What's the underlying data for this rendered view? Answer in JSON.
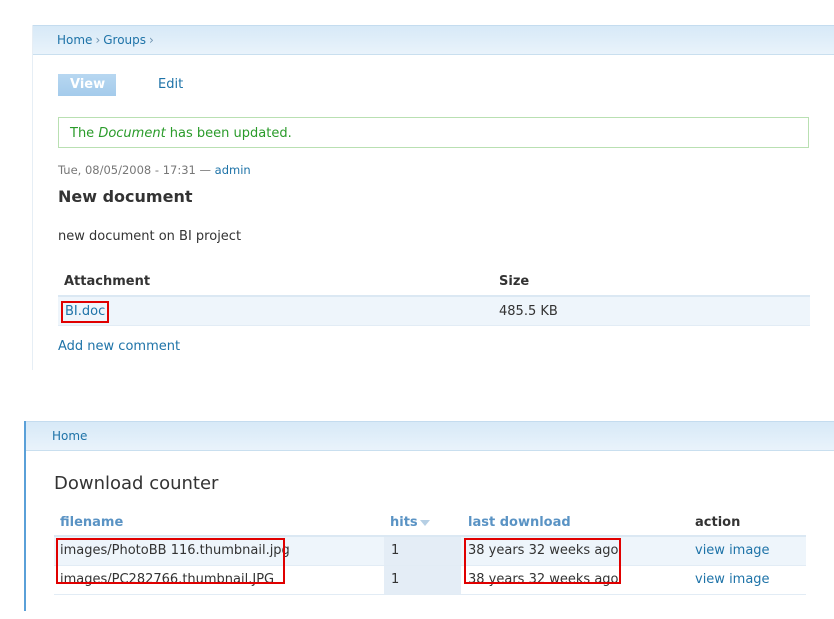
{
  "panel1": {
    "breadcrumb": [
      "Home",
      "Groups"
    ],
    "breadcrumb_sep": "›",
    "tabs": [
      "View",
      "Edit"
    ],
    "message": {
      "prefix": "The ",
      "em": "Document",
      "suffix": " has been updated."
    },
    "submitted": "Tue, 08/05/2008 - 17:31 — ",
    "author": "admin",
    "node_title": "New document",
    "body": "new document on BI project",
    "attachments": {
      "headers": [
        "Attachment",
        "Size"
      ],
      "rows": [
        {
          "file": "BI.doc",
          "size": "485.5 KB"
        }
      ]
    },
    "add_comment": "Add new comment"
  },
  "panel2": {
    "breadcrumb": [
      "Home"
    ],
    "title": "Download counter",
    "headers": [
      "filename",
      "hits",
      "last download",
      "action"
    ],
    "rows": [
      {
        "filename": "images/PhotoBB 116.thumbnail.jpg",
        "hits": "1",
        "last": "38 years 32 weeks ago",
        "action": "view image"
      },
      {
        "filename": "images/PC282766.thumbnail.JPG",
        "hits": "1",
        "last": "38 years 32 weeks ago",
        "action": "view image"
      }
    ]
  },
  "colors": {
    "link": "#1e73a8",
    "status_ok": "#2a9b2a",
    "highlight_box": "#e00000"
  }
}
